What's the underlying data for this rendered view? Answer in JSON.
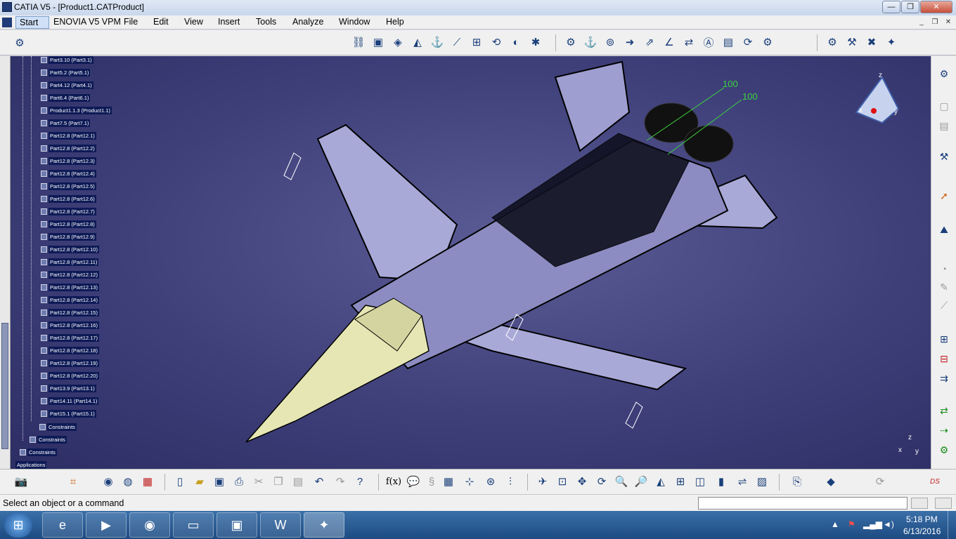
{
  "window": {
    "title": "CATIA V5 - [Product1.CATProduct]"
  },
  "menu": {
    "items": [
      "Start",
      "ENOVIA V5 VPM",
      "File",
      "Edit",
      "View",
      "Insert",
      "Tools",
      "Analyze",
      "Window",
      "Help"
    ]
  },
  "tree": {
    "items": [
      "Part3.10 (Part3.1)",
      "Part5.2 (Part5.1)",
      "Part4.12 (Part4.1)",
      "Part6.4 (Part6.1)",
      "Product1.1.3 (Product1.1)",
      "Part7.5 (Part7.1)",
      "Part12.8 (Part12.1)",
      "Part12.8 (Part12.2)",
      "Part12.8 (Part12.3)",
      "Part12.8 (Part12.4)",
      "Part12.8 (Part12.5)",
      "Part12.8 (Part12.6)",
      "Part12.8 (Part12.7)",
      "Part12.8 (Part12.8)",
      "Part12.8 (Part12.9)",
      "Part12.8 (Part12.10)",
      "Part12.8 (Part12.11)",
      "Part12.8 (Part12.12)",
      "Part12.8 (Part12.13)",
      "Part12.8 (Part12.14)",
      "Part12.8 (Part12.15)",
      "Part12.8 (Part12.16)",
      "Part12.8 (Part12.17)",
      "Part12.8 (Part12.18)",
      "Part12.8 (Part12.19)",
      "Part12.8 (Part12.20)",
      "Part13.9 (Part13.1)",
      "Part14.11 (Part14.1)",
      "Part15.1 (Part15.1)"
    ],
    "constraints": [
      "Constraints",
      "Constraints",
      "Constraints"
    ],
    "applications": "Applications"
  },
  "viewport": {
    "dimension_1": "100",
    "dimension_2": "100",
    "compass": {
      "x": "x",
      "y": "y",
      "z": "z"
    }
  },
  "status": {
    "message": "Select an object or a command"
  },
  "taskbar": {
    "time": "5:18 PM",
    "date": "6/13/2016"
  },
  "colors": {
    "viewport_bg": "#3e3f79",
    "tree_label_bg": "#0d1a56",
    "dimension": "#3cd23c",
    "taskbar": "#1d4b82"
  },
  "icons": {
    "toolbar_top": [
      "constraint-icon",
      "product-icon",
      "part-icon",
      "existing-component-icon",
      "manipulate-icon",
      "snap-icon",
      "explode-icon",
      "reorder-icon",
      "sections-icon",
      "clash-icon",
      "distance-icon",
      "fix-icon",
      "coincidence-icon",
      "contact-icon",
      "offset-icon",
      "angle-icon",
      "fix-together-icon",
      "change-constraint-icon",
      "reuse-pattern-icon",
      "update-icon",
      "flexible-icon",
      "catalog-icon",
      "generate-numbering-icon",
      "bom-icon",
      "scene-icon"
    ],
    "toolbar_right": [
      "tools-icon",
      "copy-icon",
      "paste-icon",
      "select-icon",
      "arrow-icon",
      "constraint-icon",
      "measure-icon",
      "pointer-icon",
      "axis-icon",
      "component-icon",
      "product-structure-icon",
      "bom-icon",
      "reuse-icon",
      "replace-icon",
      "catalog-icon"
    ],
    "toolbar_bottom": [
      "camera-icon",
      "compass-icon",
      "sphere-icon",
      "render-icon",
      "new-icon",
      "open-icon",
      "save-icon",
      "print-icon",
      "cut-icon",
      "copy-icon",
      "paste-icon",
      "undo-icon",
      "redo-icon",
      "help-icon",
      "formula-icon",
      "comment-icon",
      "hyperlink-icon",
      "table-icon",
      "scene-icon",
      "catalog-icon",
      "sketch-icon",
      "pan-icon",
      "fit-all-icon",
      "move-icon",
      "rotate-icon",
      "zoom-in-icon",
      "zoom-out-icon",
      "normal-view-icon",
      "multi-view-icon",
      "iso-view-icon",
      "shading-icon",
      "hide-show-icon",
      "swap-icon",
      "capture-icon",
      "layer-icon",
      "refresh-icon",
      "catia-logo-icon"
    ]
  }
}
